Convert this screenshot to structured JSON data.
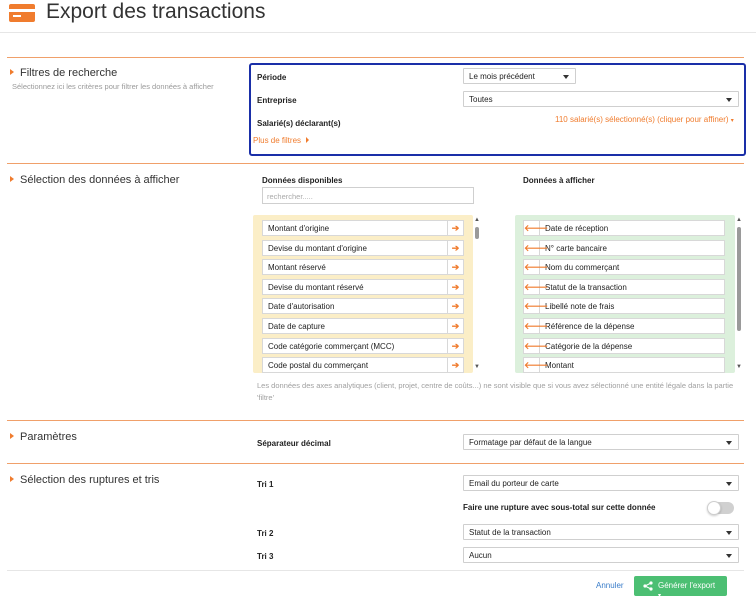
{
  "header": {
    "title": "Export des transactions",
    "icon": "credit-card-icon",
    "accent": "#f07c2e"
  },
  "filters": {
    "title": "Filtres de recherche",
    "subtitle": "Sélectionnez ici les critères pour filtrer les données à afficher",
    "periode_label": "Période",
    "periode_value": "Le mois précédent",
    "entreprise_label": "Entreprise",
    "entreprise_value": "Toutes",
    "salaries_label": "Salarié(s) déclarant(s)",
    "salaries_value": "110 salarié(s) sélectionné(s) (cliquer pour affiner)",
    "more_filters": "Plus de filtres",
    "highlight_color": "#1a2fa8"
  },
  "selection": {
    "title": "Sélection des données à afficher",
    "available_title": "Données disponibles",
    "search_placeholder": "rechercher.....",
    "display_title": "Données à afficher",
    "available_items": [
      "Montant d'origine",
      "Devise du montant d'origine",
      "Montant réservé",
      "Devise du montant réservé",
      "Date d'autorisation",
      "Date de capture",
      "Code catégorie commerçant (MCC)",
      "Code postal du commerçant"
    ],
    "display_items": [
      "Date de réception",
      "N° carte bancaire",
      "Nom du commerçant",
      "Statut de la transaction",
      "Libellé note de frais",
      "Référence de la dépense",
      "Catégorie de la dépense",
      "Montant"
    ],
    "note": "Les données des axes analytiques (client, projet, centre de coûts...) ne sont visible que si vous avez sélectionné une entité légale dans la partie 'filtre'",
    "available_bg": "#fbeec7",
    "display_bg": "#dcf0dc"
  },
  "params": {
    "title": "Paramètres",
    "separator_label": "Séparateur décimal",
    "separator_value": "Formatage par défaut de la langue"
  },
  "sorting": {
    "title": "Sélection des ruptures et tris",
    "tri1_label": "Tri 1",
    "tri1_value": "Email du porteur de carte",
    "rupture_label": "Faire une rupture avec sous-total sur cette donnée",
    "rupture_on": false,
    "tri2_label": "Tri 2",
    "tri2_value": "Statut de la transaction",
    "tri3_label": "Tri 3",
    "tri3_value": "Aucun"
  },
  "footer": {
    "cancel_label": "Annuler",
    "generate_label": "Générer l'export",
    "generate_icon": "share-icon",
    "generate_color": "#4cbf73"
  }
}
